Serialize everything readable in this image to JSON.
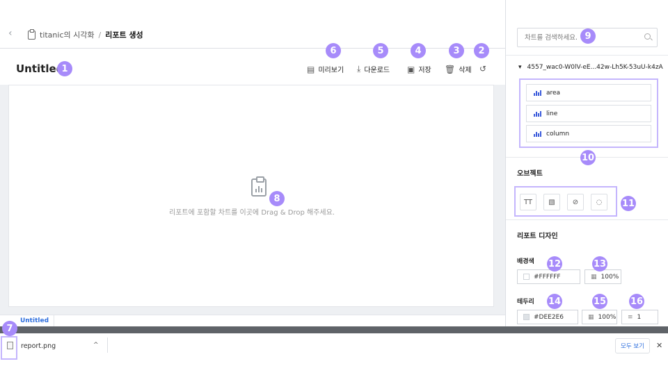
{
  "header": {
    "back_icon": "chevron-left-icon",
    "breadcrumb_parent": "titanic의 시각화",
    "breadcrumb_sep": "/",
    "breadcrumb_current": "리포트 생성"
  },
  "page_title": "Untitled",
  "toolbar": {
    "preview": "미리보기",
    "download": "다운로드",
    "save": "저장",
    "delete": "삭제",
    "refresh_icon": "refresh-icon"
  },
  "canvas": {
    "hint": "리포트에 포함할 차트를 이곳에 Drag & Drop 해주세요."
  },
  "tabs": [
    {
      "label": "Untitled"
    }
  ],
  "sidebar": {
    "search_placeholder": "차트를 검색하세요.",
    "dataset_toggle": "▾",
    "dataset_name": "4557_wac0-W0lV-eE...42w-Lh5K-53uU-k4zA",
    "charts": [
      {
        "label": "area"
      },
      {
        "label": "line"
      },
      {
        "label": "column"
      }
    ],
    "objects_title": "오브젝트",
    "objects": [
      "TT",
      "image-icon",
      "link-icon",
      "select-area-icon"
    ],
    "design_title": "리포트 디자인",
    "background_label": "배경색",
    "background_color": "#FFFFFF",
    "background_opacity": "100%",
    "border_label": "테두리",
    "border_color": "#DEE2E6",
    "border_opacity": "100%",
    "border_width": "1"
  },
  "download_bar": {
    "file_name": "report.png",
    "show_all": "모두 보기",
    "close": "✕"
  },
  "badges": [
    "1",
    "2",
    "3",
    "4",
    "5",
    "6",
    "7",
    "8",
    "9",
    "10",
    "11",
    "12",
    "13",
    "14",
    "15",
    "16"
  ],
  "accent_color": "#a78bfa"
}
